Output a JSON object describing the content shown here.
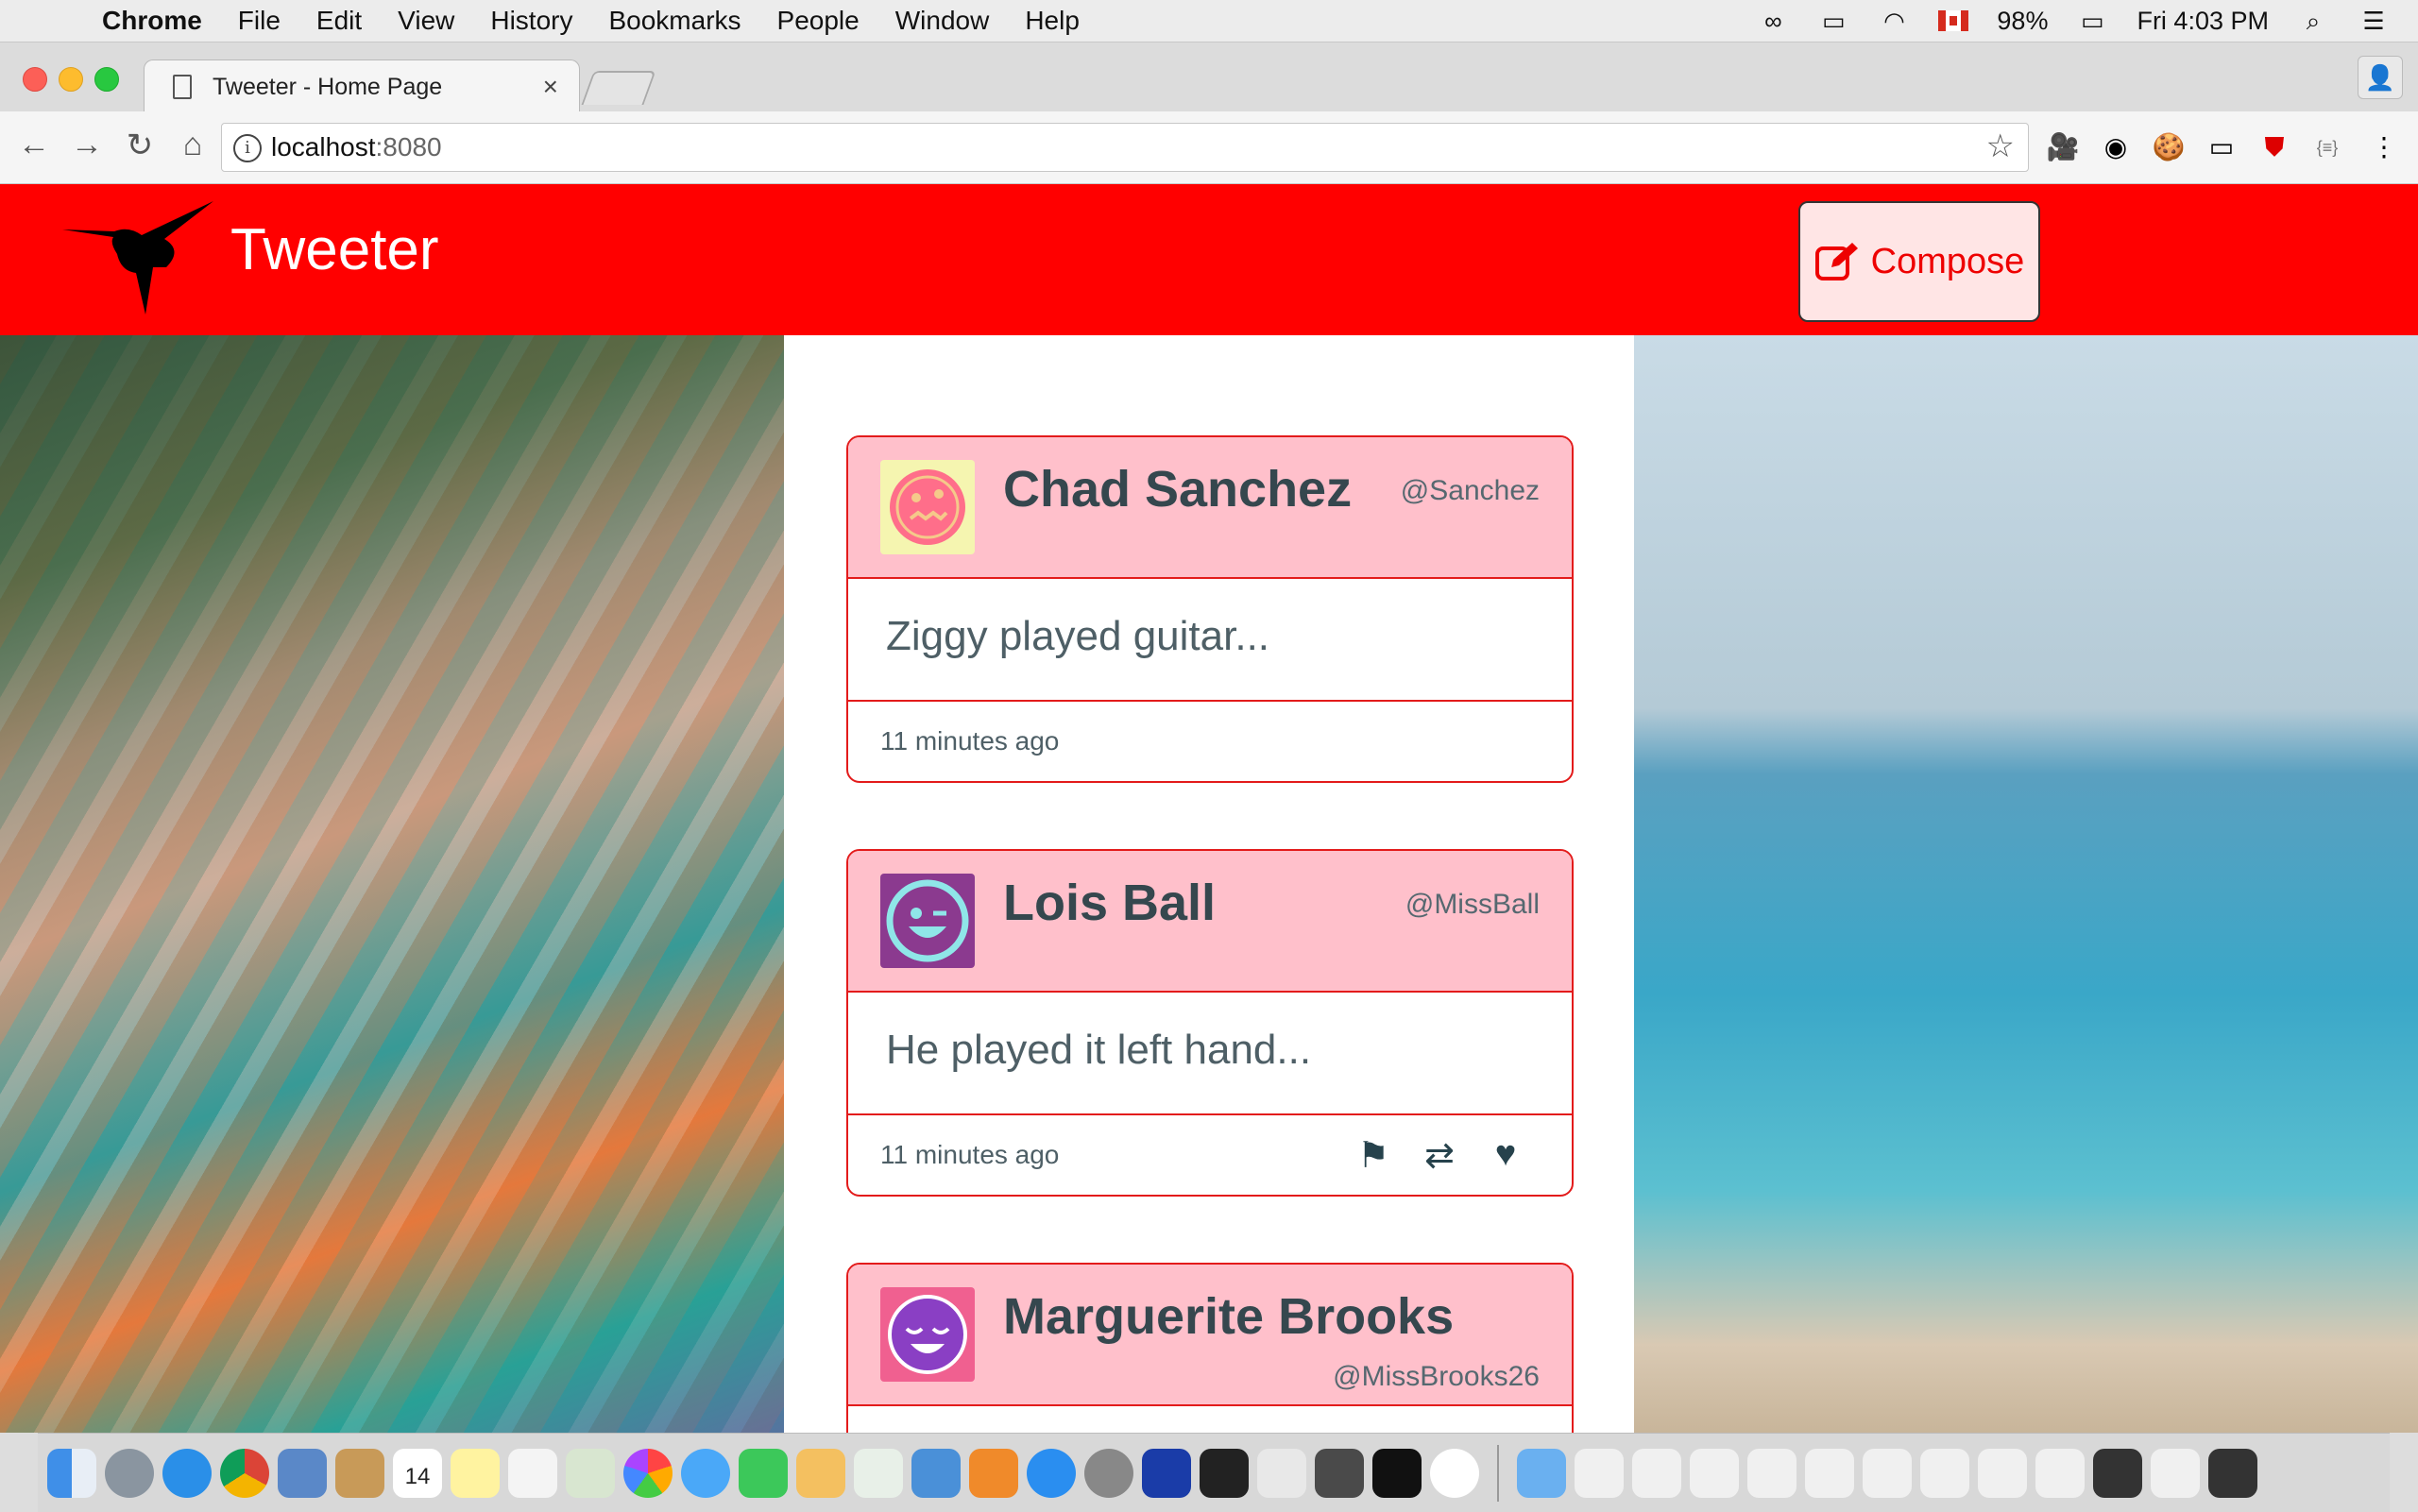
{
  "menubar": {
    "app": "Chrome",
    "items": [
      "File",
      "Edit",
      "View",
      "History",
      "Bookmarks",
      "People",
      "Window",
      "Help"
    ],
    "battery": "98%",
    "clock": "Fri 4:03 PM"
  },
  "browser": {
    "tab_title": "Tweeter - Home Page",
    "url_host": "localhost",
    "url_port": ":8080"
  },
  "app": {
    "brand": "Tweeter",
    "compose_label": "Compose",
    "header_color": "#ff0000"
  },
  "tweets": [
    {
      "name": "Chad Sanchez",
      "handle": "@Sanchez",
      "text": "Ziggy played guitar...",
      "time": "11 minutes ago",
      "avatar_icon": "pizza-face-icon"
    },
    {
      "name": "Lois Ball",
      "handle": "@MissBall",
      "text": "He played it left hand...",
      "time": "11 minutes ago",
      "avatar_icon": "winking-face-icon"
    },
    {
      "name": "Marguerite Brooks",
      "handle": "@MissBrooks26",
      "avatar_icon": "sleepy-face-icon"
    }
  ],
  "dock": {
    "calendar_day": "14"
  }
}
